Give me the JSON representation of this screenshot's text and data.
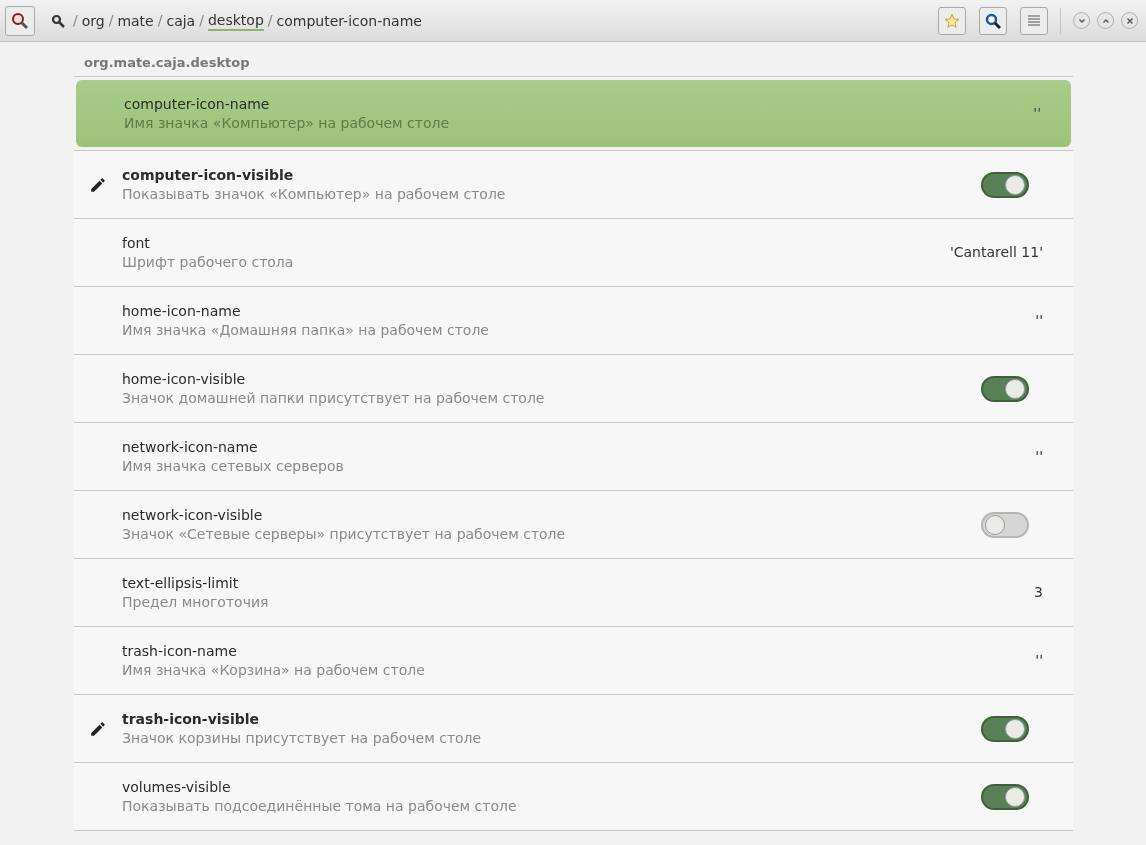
{
  "path": [
    {
      "separator": "/",
      "label": "org",
      "selected": false
    },
    {
      "separator": "/",
      "label": "mate",
      "selected": false
    },
    {
      "separator": "/",
      "label": "caja",
      "selected": false
    },
    {
      "separator": "/",
      "label": "desktop",
      "selected": true
    },
    {
      "separator": "/",
      "label": "computer-icon-name",
      "selected": false
    }
  ],
  "group_title": "org.mate.caja.desktop",
  "rows": [
    {
      "kind": "text",
      "name": "computer-icon-name",
      "description": "Имя значка «Компьютер» на рабочем столе",
      "value": "''",
      "modified": false,
      "selected": true
    },
    {
      "kind": "switch",
      "name": "computer-icon-visible",
      "description": "Показывать значок «Компьютер» на рабочем столе",
      "on": true,
      "modified": true,
      "selected": false
    },
    {
      "kind": "text",
      "name": "font",
      "description": "Шрифт рабочего стола",
      "value": "'Cantarell 11'",
      "modified": false,
      "selected": false
    },
    {
      "kind": "text",
      "name": "home-icon-name",
      "description": "Имя значка «Домашняя папка» на рабочем столе",
      "value": "''",
      "modified": false,
      "selected": false
    },
    {
      "kind": "switch",
      "name": "home-icon-visible",
      "description": "Значок домашней папки присутствует на рабочем столе",
      "on": true,
      "modified": false,
      "selected": false
    },
    {
      "kind": "text",
      "name": "network-icon-name",
      "description": "Имя значка сетевых серверов",
      "value": "''",
      "modified": false,
      "selected": false
    },
    {
      "kind": "switch",
      "name": "network-icon-visible",
      "description": "Значок «Сетевые серверы» присутствует на рабочем столе",
      "on": false,
      "modified": false,
      "selected": false
    },
    {
      "kind": "text",
      "name": "text-ellipsis-limit",
      "description": "Предел многоточия",
      "value": "3",
      "modified": false,
      "selected": false
    },
    {
      "kind": "text",
      "name": "trash-icon-name",
      "description": "Имя значка «Корзина» на рабочем столе",
      "value": "''",
      "modified": false,
      "selected": false
    },
    {
      "kind": "switch",
      "name": "trash-icon-visible",
      "description": "Значок корзины присутствует на рабочем столе",
      "on": true,
      "modified": true,
      "selected": false
    },
    {
      "kind": "switch",
      "name": "volumes-visible",
      "description": "Показывать подсоединённые тома на рабочем столе",
      "on": true,
      "modified": false,
      "selected": false
    }
  ]
}
